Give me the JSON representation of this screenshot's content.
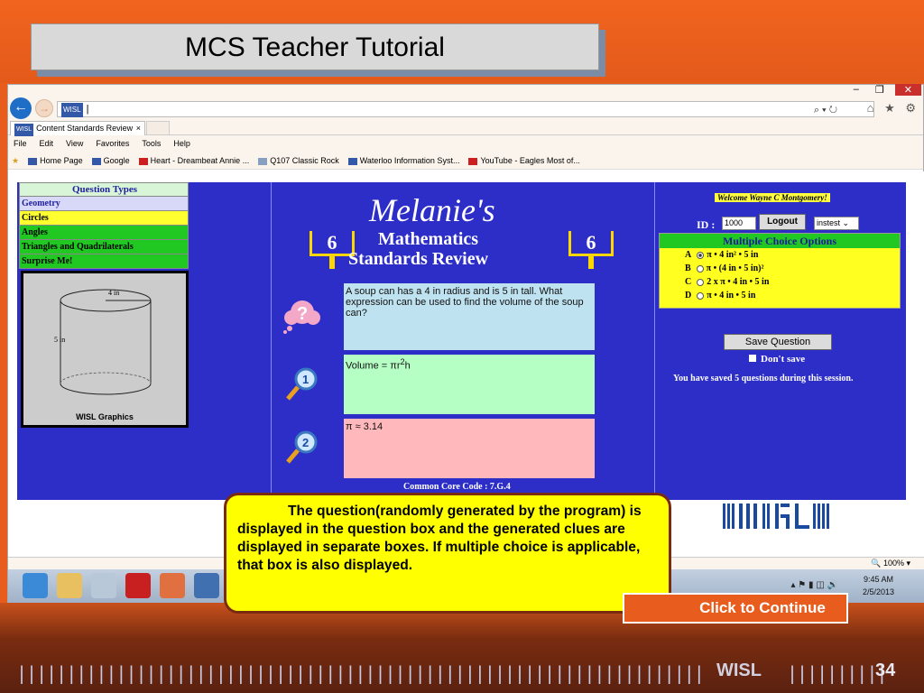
{
  "slide": {
    "title": "MCS Teacher Tutorial",
    "callout": "The question(randomly generated by the program) is displayed in the question box and the generated clues are displayed in separate boxes. If multiple choice is applicable, that box is also displayed.",
    "continue": "Click to Continue",
    "footer_brand": "WISL",
    "page_number": "34"
  },
  "browser": {
    "address": "|",
    "address_favicon": "WISL",
    "tab_title": "Content Standards Review",
    "tab_close": "×",
    "menu": [
      "File",
      "Edit",
      "View",
      "Favorites",
      "Tools",
      "Help"
    ],
    "favorites": [
      "Home Page",
      "Google",
      "Heart - Dreambeat Annie ...",
      "Q107 Classic Rock",
      "Waterloo Information Syst...",
      "YouTube - Eagles Most of..."
    ],
    "zoom": "100%",
    "clock_time": "9:45 AM",
    "clock_date": "2/5/2013"
  },
  "question_types": {
    "header": "Question Types",
    "items": [
      "Geometry",
      "Circles",
      "Angles",
      "Triangles and Quadrilaterals",
      "Surprise Me!"
    ]
  },
  "graphic": {
    "caption": "WISL Graphics",
    "label_radius": "4 in",
    "label_height": "5 in"
  },
  "logo": {
    "name": "Melanie's",
    "line1": "Mathematics",
    "line2": "Standards Review",
    "grade": "6"
  },
  "question": {
    "text": "A soup can has a 4 in radius and is 5 in tall. What expression can be used to find the volume of the soup can?",
    "clue1_prefix": "Volume = πr",
    "clue1_sup": "2",
    "clue1_suffix": "h",
    "clue2": "π ≈ 3.14",
    "common_core": "Common Core Code : 7.G.4"
  },
  "right_panel": {
    "welcome": "Welcome Wayne C Montgomery!",
    "id_label": "ID :",
    "id_value": "1000",
    "logout": "Logout",
    "test_select": "instest",
    "mc_header": "Multiple Choice Options",
    "options": [
      {
        "letter": "A",
        "text": "π • 4 in² • 5 in",
        "selected": true
      },
      {
        "letter": "B",
        "text": "π • (4 in • 5 in)²",
        "selected": false
      },
      {
        "letter": "C",
        "text": "2 x π • 4 in • 5 in",
        "selected": false
      },
      {
        "letter": "D",
        "text": "π • 4 in • 5 in",
        "selected": false
      }
    ],
    "save_button": "Save Question",
    "dont_save": "Don't save",
    "session_note": "You have saved 5 questions during this session."
  },
  "colors": {
    "slide_orange": "#e85d1e",
    "app_blue": "#2d2dc8",
    "callout_yellow": "#ffff00"
  }
}
